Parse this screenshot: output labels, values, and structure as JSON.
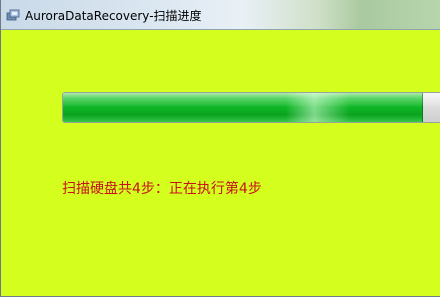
{
  "window": {
    "title": "AuroraDataRecovery-扫描进度",
    "app_icon": "aurora-app-icon",
    "background_color": "#d4ff1e"
  },
  "scan": {
    "progress": 0.95,
    "progress_color": "#0fb527",
    "status": "扫描硬盘共4步：正在执行第4步",
    "status_color": "#c8121a"
  }
}
